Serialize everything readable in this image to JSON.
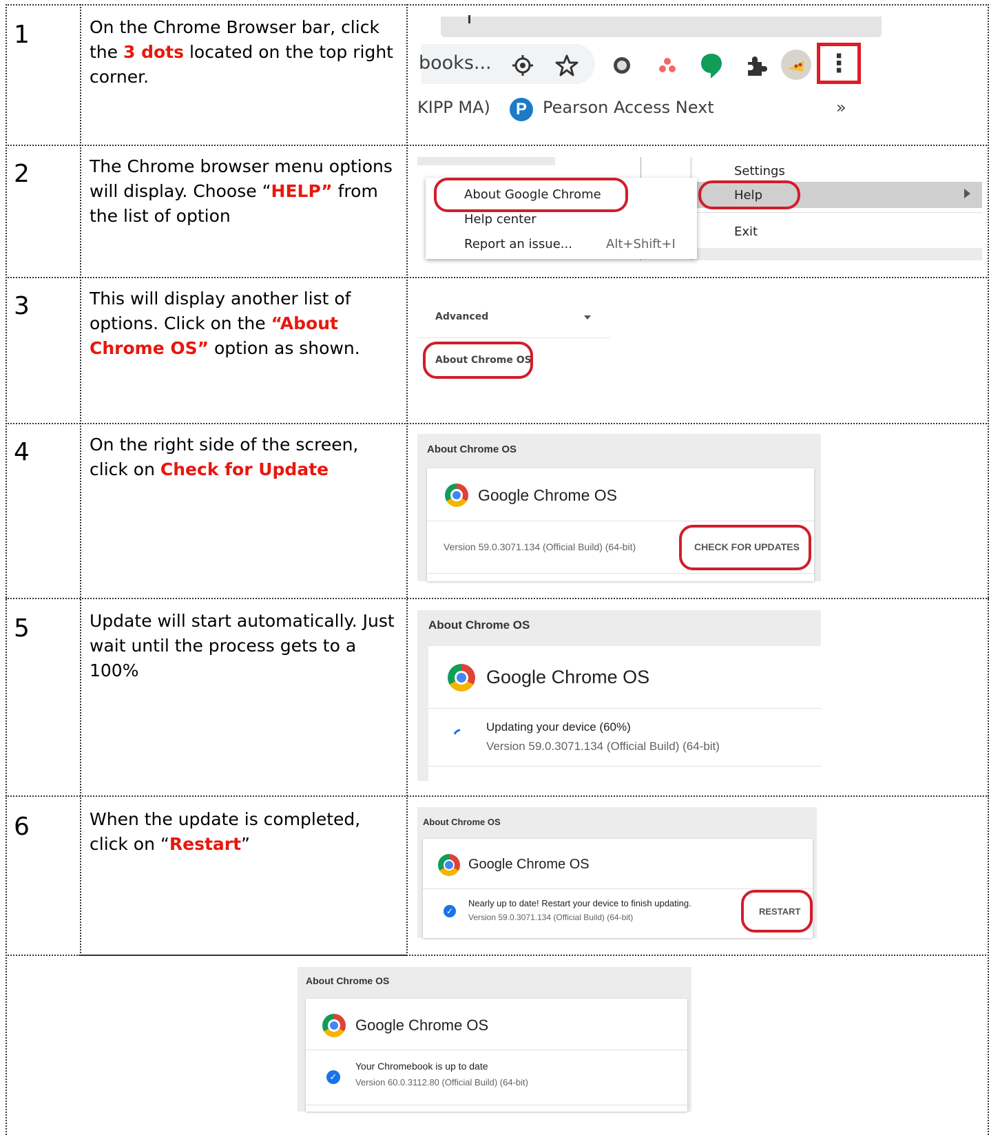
{
  "steps": [
    {
      "number": "1",
      "text_before": "On the Chrome Browser bar, click the ",
      "highlight": "3 dots",
      "text_after": " located on the top right corner."
    },
    {
      "number": "2",
      "text_before": "The Chrome browser menu options will display. Choose “",
      "highlight": "HELP”",
      "text_after": " from the list of option"
    },
    {
      "number": "3",
      "text_before": "This will display another list of options. Click on the ",
      "highlight": "“About Chrome OS”",
      "text_after": " option as shown."
    },
    {
      "number": "4",
      "text_before": "On the right side of the screen, click on ",
      "highlight": "Check for Update",
      "text_after": ""
    },
    {
      "number": "5",
      "text_before": "Update will start automatically. Just wait until the process gets to a 100%",
      "highlight": "",
      "text_after": ""
    },
    {
      "number": "6",
      "text_before": "When the update is completed, click on “",
      "highlight": "Restart",
      "text_after": "”"
    }
  ],
  "shot1": {
    "address_text": "books...",
    "bookmark_1": "KIPP MA)",
    "bookmark_2": "Pearson Access Next",
    "bookmark_2_icon_letter": "P",
    "more_bookmarks": "»",
    "menu_dots": "⋮"
  },
  "shot2": {
    "submenu": [
      "About Google Chrome",
      "Help center",
      "Report an issue..."
    ],
    "shortcut": "Alt+Shift+I",
    "main_menu": [
      "Settings",
      "Help",
      "Exit"
    ]
  },
  "shot3": {
    "advanced": "Advanced",
    "about": "About Chrome OS"
  },
  "shot4": {
    "title": "About Chrome OS",
    "name": "Google Chrome OS",
    "version": "Version 59.0.3071.134 (Official Build) (64-bit)",
    "button": "CHECK FOR UPDATES"
  },
  "shot5": {
    "title": "About Chrome OS",
    "name": "Google Chrome OS",
    "status": "Updating your device (60%)",
    "progress": 0.6,
    "version": "Version 59.0.3071.134 (Official Build) (64-bit)"
  },
  "shot6": {
    "title": "About Chrome OS",
    "name": "Google Chrome OS",
    "status": "Nearly up to date! Restart your device to finish updating.",
    "version": "Version 59.0.3071.134 (Official Build) (64-bit)",
    "button": "RESTART"
  },
  "shot7": {
    "title": "About Chrome OS",
    "name": "Google Chrome OS",
    "status": "Your Chromebook is up to date",
    "version": "Version 60.0.3112.80 (Official Build) (64-bit)"
  },
  "colors": {
    "highlight_red": "#e8170d",
    "annotation_red": "#d11d2a",
    "check_blue": "#1a73e8"
  }
}
